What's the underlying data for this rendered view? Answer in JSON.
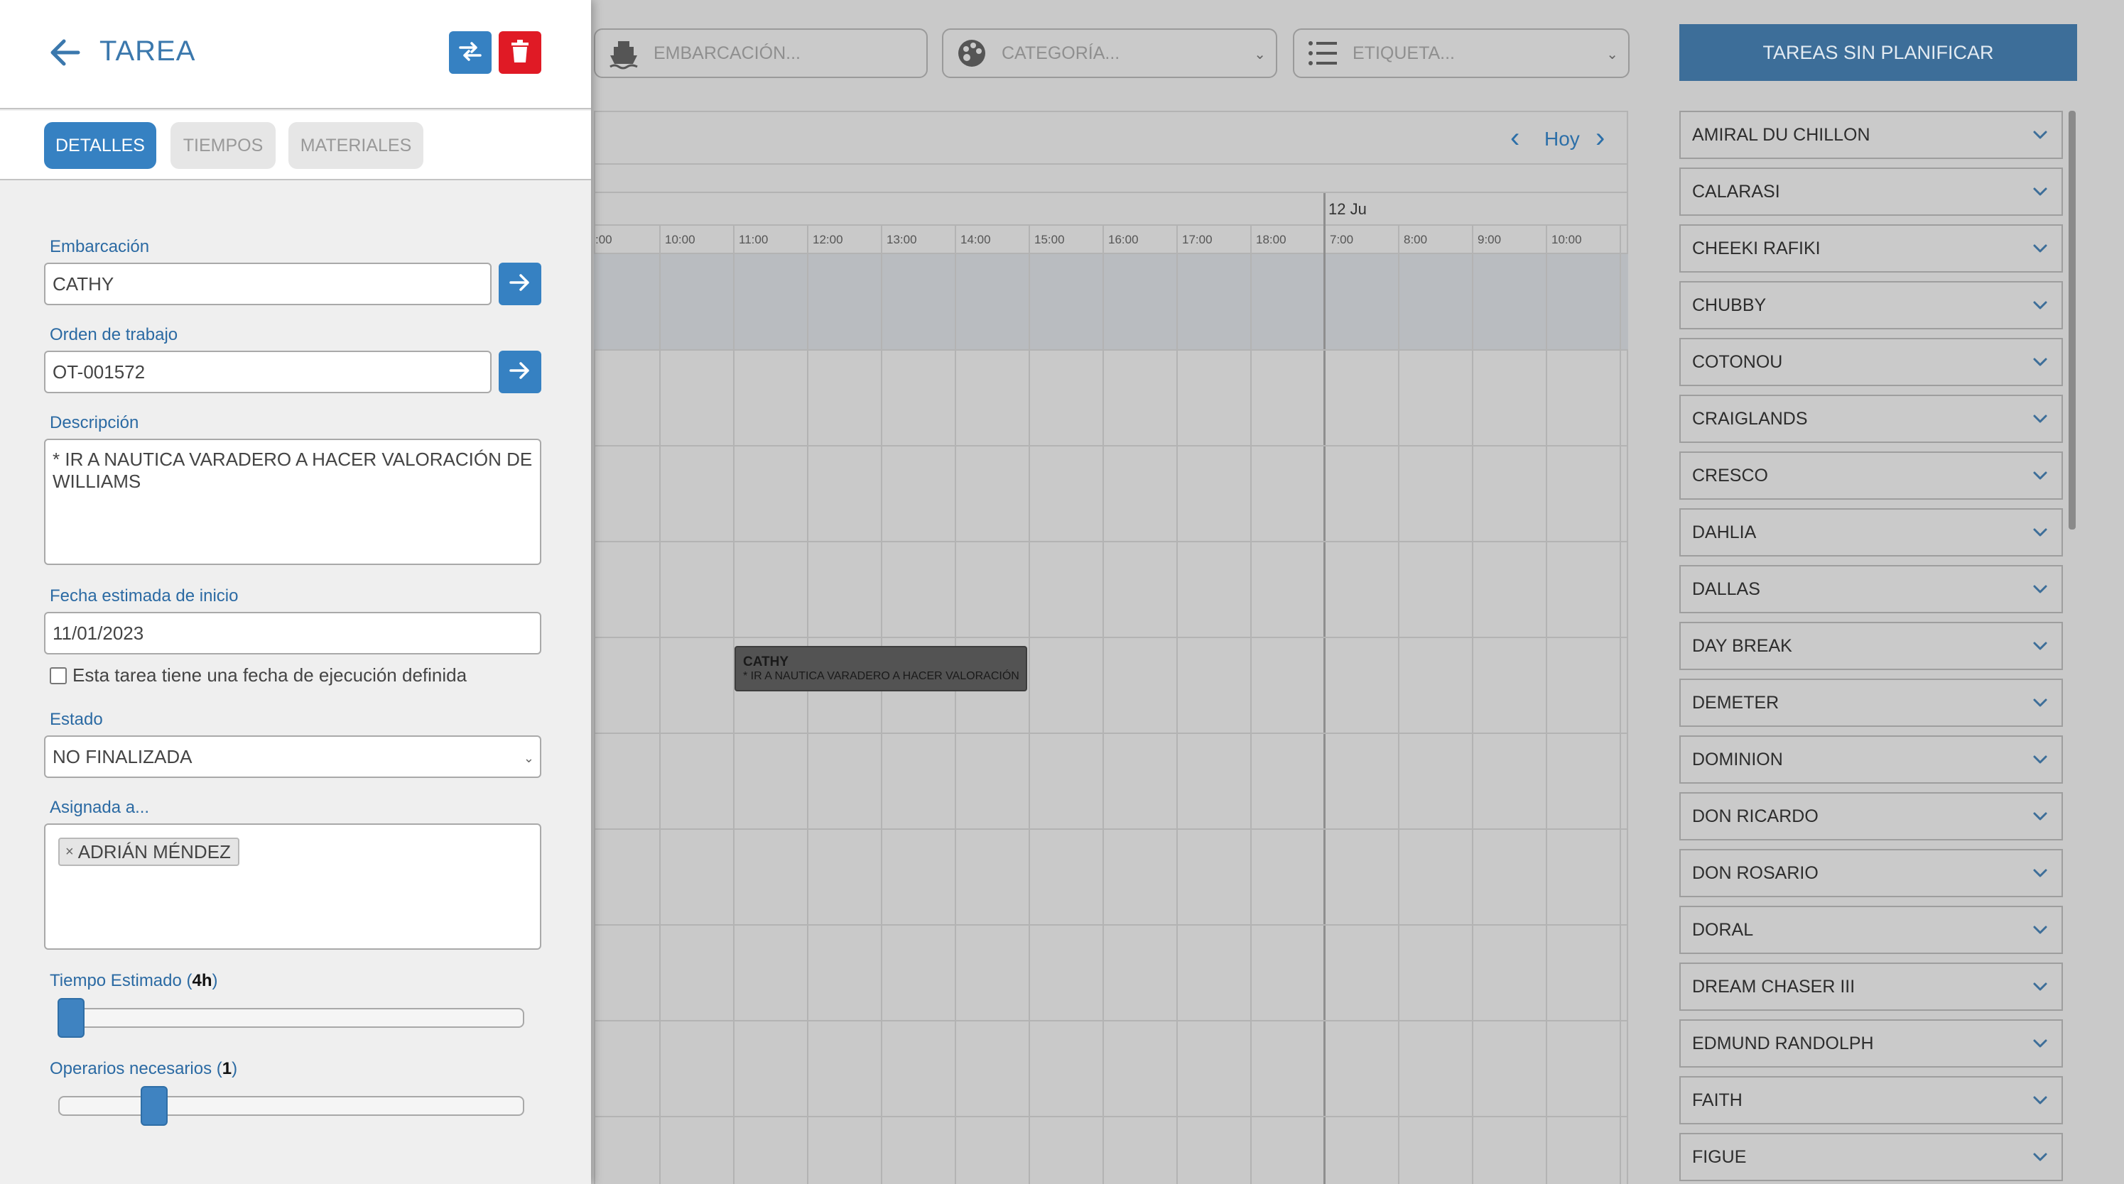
{
  "filters": {
    "boat_placeholder": "EMBARCACIÓN...",
    "category_placeholder": "CATEGORÍA...",
    "tag_placeholder": "ETIQUETA..."
  },
  "calendar": {
    "today_label": "Hoy",
    "day_label": "12 Ju",
    "hours": [
      ":00",
      "10:00",
      "11:00",
      "12:00",
      "13:00",
      "14:00",
      "15:00",
      "16:00",
      "17:00",
      "18:00",
      "7:00",
      "8:00",
      "9:00",
      "10:00"
    ],
    "event": {
      "title": "CATHY",
      "description": "* IR A NAUTICA VARADERO A HACER VALORACIÓN"
    }
  },
  "unplanned": {
    "button_label": "TAREAS SIN PLANIFICAR",
    "boats": [
      "AMIRAL DU CHILLON",
      "CALARASI",
      "CHEEKI RAFIKI",
      "CHUBBY",
      "COTONOU",
      "CRAIGLANDS",
      "CRESCO",
      "DAHLIA",
      "DALLAS",
      "DAY BREAK",
      "DEMETER",
      "DOMINION",
      "DON RICARDO",
      "DON ROSARIO",
      "DORAL",
      "DREAM CHASER III",
      "EDMUND RANDOLPH",
      "FAITH",
      "FIGUE"
    ]
  },
  "drawer": {
    "title": "TAREA",
    "tabs": [
      "DETALLES",
      "TIEMPOS",
      "MATERIALES"
    ],
    "fields": {
      "boat_label": "Embarcación",
      "boat_value": "CATHY",
      "work_order_label": "Orden de trabajo",
      "work_order_value": "OT-001572",
      "description_label": "Descripción",
      "description_value": "* IR A NAUTICA VARADERO A HACER VALORACIÓN DE WILLIAMS",
      "start_date_label": "Fecha estimada de inicio",
      "start_date_value": "11/01/2023",
      "fixed_date_checkbox_label": "Esta tarea tiene una fecha de ejecución definida",
      "fixed_date_checked": false,
      "status_label": "Estado",
      "status_value": "NO FINALIZADA",
      "assigned_label": "Asignada a...",
      "assigned_users": [
        "ADRIÁN MÉNDEZ"
      ],
      "estimated_time_label": "Tiempo Estimado (",
      "estimated_time_value": "4h",
      "estimated_time_close": ")",
      "estimated_time_hours": 4,
      "operators_label": "Operarios necesarios (",
      "operators_value": "1",
      "operators_close": ")",
      "operators_count": 1
    }
  },
  "colors": {
    "primary": "#3681c2",
    "danger": "#e01a25",
    "header_bar": "#3d6e99",
    "label_blue": "#2b6aa3"
  }
}
